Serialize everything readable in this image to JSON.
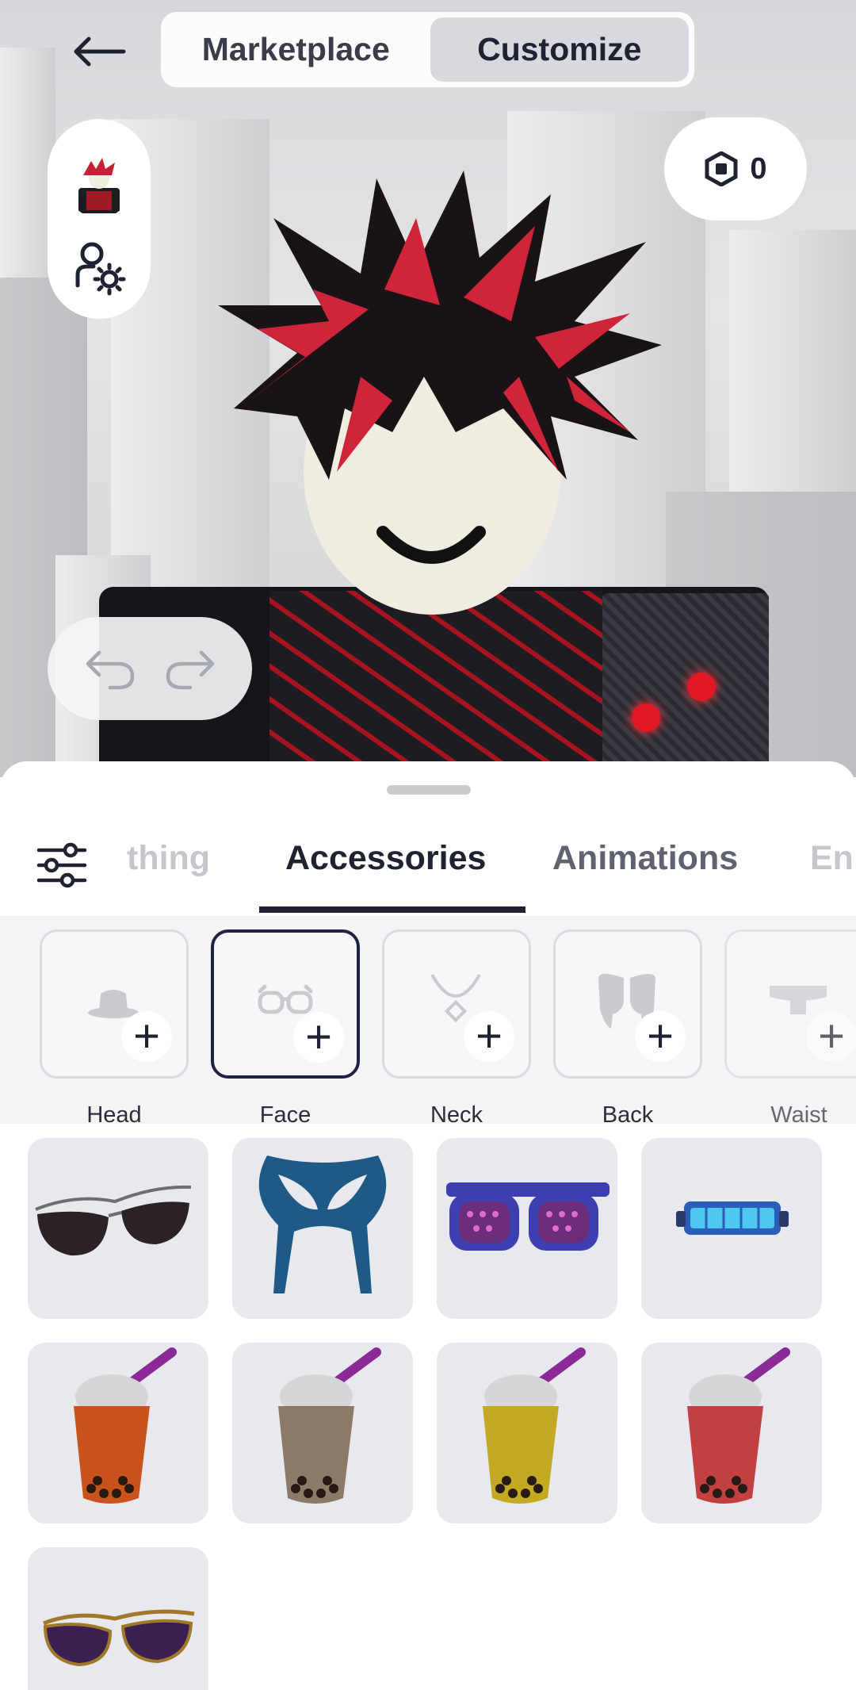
{
  "header": {
    "back_icon": "arrow-left-icon",
    "segments": [
      {
        "label": "Marketplace",
        "active": false
      },
      {
        "label": "Customize",
        "active": true
      }
    ]
  },
  "robux": {
    "icon": "robux-icon",
    "balance": "0"
  },
  "side_panel": {
    "avatar_icon": "avatar-thumbnail",
    "settings_icon": "avatar-settings-icon"
  },
  "history": {
    "undo_icon": "undo-icon",
    "redo_icon": "redo-icon"
  },
  "tabs": {
    "filter_icon": "filter-sliders-icon",
    "items": [
      {
        "label": "thing",
        "active": false
      },
      {
        "label": "Accessories",
        "active": true
      },
      {
        "label": "Animations",
        "active": false
      },
      {
        "label": "En",
        "active": false
      }
    ]
  },
  "subcategories": [
    {
      "label": "Head",
      "icon": "hat-icon",
      "selected": false
    },
    {
      "label": "Face",
      "icon": "glasses-icon",
      "selected": true
    },
    {
      "label": "Neck",
      "icon": "necklace-icon",
      "selected": false
    },
    {
      "label": "Back",
      "icon": "wings-icon",
      "selected": false
    },
    {
      "label": "Waist",
      "icon": "belt-icon",
      "selected": false
    }
  ],
  "plus_glyph": "+",
  "items": [
    {
      "name": "aviator-sunglasses"
    },
    {
      "name": "blue-hero-mask"
    },
    {
      "name": "purple-shutter-shades"
    },
    {
      "name": "cyber-visor"
    },
    {
      "name": "bubble-tea-orange"
    },
    {
      "name": "bubble-tea-brown"
    },
    {
      "name": "bubble-tea-yellow"
    },
    {
      "name": "bubble-tea-red"
    },
    {
      "name": "purple-aviator-sunglasses"
    }
  ],
  "colors": {
    "accent": "#1f2230",
    "tile_bg": "#e8e9ee",
    "hair_red": "#d0243a"
  }
}
